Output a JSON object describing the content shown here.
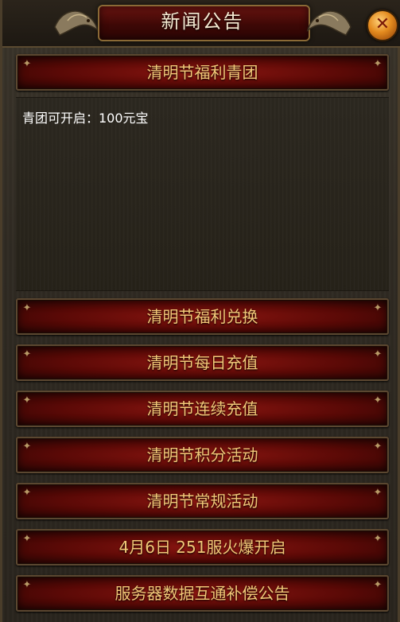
{
  "title": "新闻公告",
  "close_symbol": "✕",
  "active_notice": {
    "title": "清明节福利青团",
    "body": "青团可开启：100元宝"
  },
  "notices": [
    {
      "title": "清明节福利兑换"
    },
    {
      "title": "清明节每日充值"
    },
    {
      "title": "清明节连续充值"
    },
    {
      "title": "清明节积分活动"
    },
    {
      "title": "清明节常规活动"
    },
    {
      "title": "4月6日 251服火爆开启"
    },
    {
      "title": "服务器数据互通补偿公告"
    }
  ],
  "colors": {
    "button_text": "#f2c878",
    "button_bg": "#6a0c08",
    "frame": "#5b4730"
  },
  "icons": {
    "close": "close-icon",
    "dragon": "dragon-ornament-icon",
    "corner": "corner-ornament-icon"
  }
}
